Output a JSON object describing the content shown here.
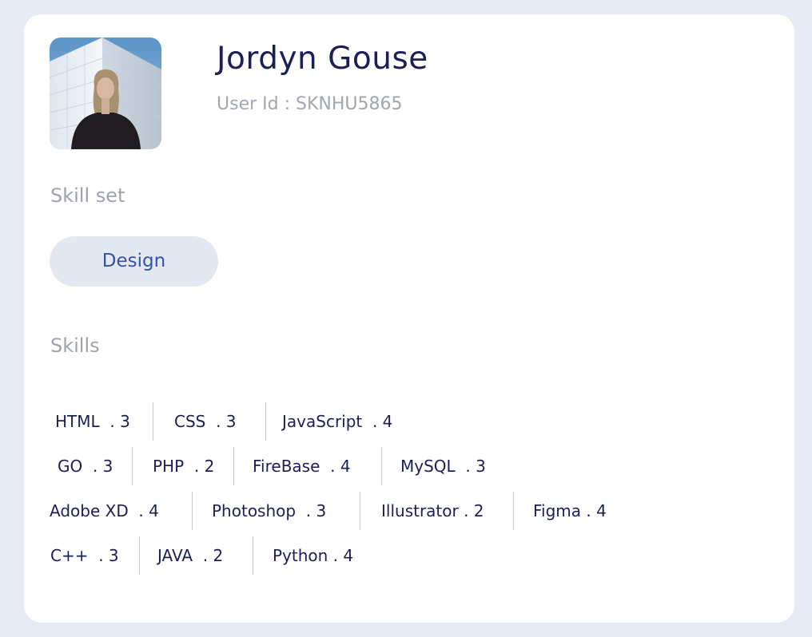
{
  "profile": {
    "name": "Jordyn Gouse",
    "user_id": "User Id : SKNHU5865"
  },
  "skillset": {
    "label": "Skill set",
    "category": "Design"
  },
  "skills": {
    "label": "Skills",
    "rows": [
      [
        "HTML  . 3",
        "CSS  . 3",
        "JavaScript  . 4"
      ],
      [
        "GO  . 3",
        "PHP  . 2",
        "FireBase  . 4",
        "MySQL  . 3"
      ],
      [
        "Adobe XD  . 4",
        "Photoshop  . 3",
        "Illustrator . 2",
        "Figma . 4"
      ],
      [
        "C++  . 3",
        "JAVA  . 2",
        "Python . 4"
      ]
    ]
  },
  "colors": {
    "background": "#e6ebf6",
    "card": "#ffffff",
    "name": "#1b1f56",
    "muted": "#9ea3ad",
    "pill_bg": "#e4e8f0",
    "pill_text": "#3354a6"
  }
}
